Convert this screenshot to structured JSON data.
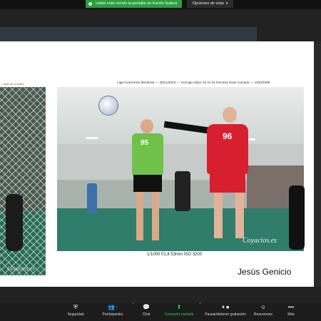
{
  "banner": {
    "sharing_notice": "Usted está viendo la pantalla de Karolo Suárez",
    "view_options": "Opciones de vista"
  },
  "slide": {
    "title": "Liga Guerreras Iberdrola — 2021/2022 — Unicaja Gijón 23 vs 22 Rocasa Gran Canaria — 20220309",
    "left_caption": "...ación de La Araña",
    "left_watermark": "Coyacios.es",
    "main_watermark": "Coyacios.es",
    "exif": "1/1000 f/1,8 53mm ISO 3200",
    "author": "Jesús Genicio",
    "jersey_green": "95",
    "jersey_red": "96"
  },
  "toolbar": {
    "items": [
      {
        "label": "Seguridad",
        "icon": "shield-icon"
      },
      {
        "label": "Participantes",
        "icon": "participants-icon",
        "count": "7"
      },
      {
        "label": "Chat",
        "icon": "chat-icon"
      },
      {
        "label": "Compartir pantalla",
        "icon": "share-screen-icon"
      },
      {
        "label": "Pausar/detener grabación",
        "icon": "pause-record-icon"
      },
      {
        "label": "Reacciones",
        "icon": "reactions-icon"
      },
      {
        "label": "Más",
        "icon": "more-icon"
      }
    ],
    "share_color": "#2ecc40"
  }
}
